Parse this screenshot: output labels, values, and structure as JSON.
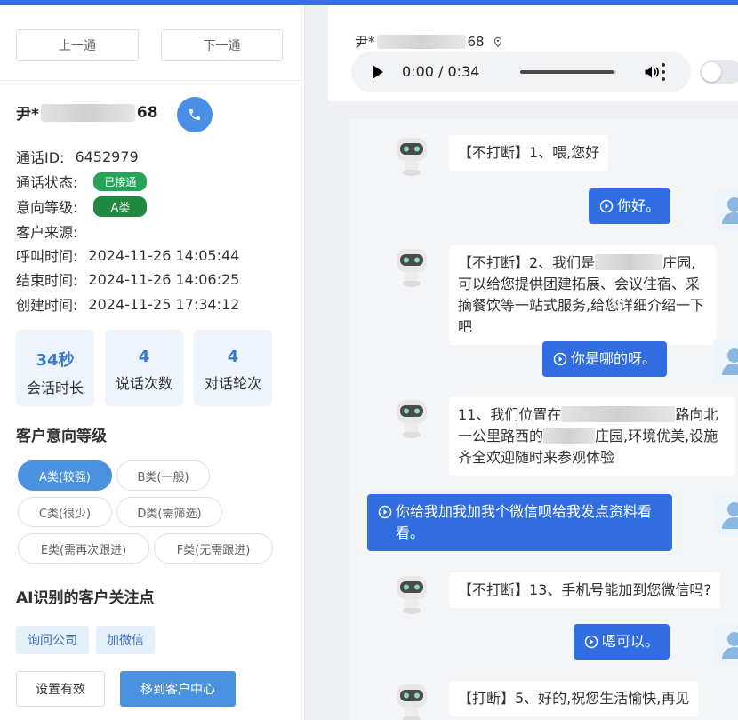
{
  "nav": {
    "prev": "上一通",
    "next": "下一通"
  },
  "customer": {
    "name_prefix": "尹*",
    "name_suffix": "68"
  },
  "info": [
    {
      "label": "通话ID:",
      "value": "6452979"
    },
    {
      "label": "通话状态:",
      "badge": "已接通"
    },
    {
      "label": "意向等级:",
      "badge": "A类"
    },
    {
      "label": "客户来源:",
      "value": ""
    },
    {
      "label": "呼叫时间:",
      "value": "2024-11-26 14:05:44"
    },
    {
      "label": "结束时间:",
      "value": "2024-11-26 14:06:25"
    },
    {
      "label": "创建时间:",
      "value": "2024-11-25 17:34:12"
    }
  ],
  "stats": [
    {
      "num": "34秒",
      "cap": "会话时长"
    },
    {
      "num": "4",
      "cap": "说话次数"
    },
    {
      "num": "4",
      "cap": "对话轮次"
    }
  ],
  "intent": {
    "title": "客户意向等级",
    "tags": [
      "A类(较强)",
      "B类(一般)",
      "C类(很少)",
      "D类(需筛选)",
      "E类(需再次跟进)",
      "F类(无需跟进)"
    ]
  },
  "focus": {
    "title": "AI识别的客户关注点",
    "tags": [
      "询问公司",
      "加微信"
    ]
  },
  "actions": {
    "set_valid": "设置有效",
    "move": "移到客户中心"
  },
  "right_header": {
    "name_prefix": "尹*",
    "name_suffix": "68"
  },
  "audio": {
    "time": "0:00 / 0:34",
    "progress": 0.97
  },
  "chat": {
    "m1": "【不打断】1、喂,您好",
    "u1": "你好。",
    "m2a": "【不打断】2、我们是",
    "m2b": "庄园,可以给您提供团建拓展、会议住宿、采摘餐饮等一站式服务,给您详细介绍一下吧",
    "u2": "你是哪的呀。",
    "m3a": "11、我们位置在",
    "m3b": "路向北一公里路西的",
    "m3c": "庄园,环境优美,设施齐全欢迎随时来参观体验",
    "u3": "你给我加我加我个微信呗给我发点资料看看。",
    "m4": "【不打断】13、手机号能加到您微信吗?",
    "u4": "嗯可以。",
    "m5": "【打断】5、好的,祝您生活愉快,再见"
  },
  "colors": {
    "accent": "#4a92e0",
    "user_bubble": "#2f6de0",
    "success": "#27a35a"
  }
}
